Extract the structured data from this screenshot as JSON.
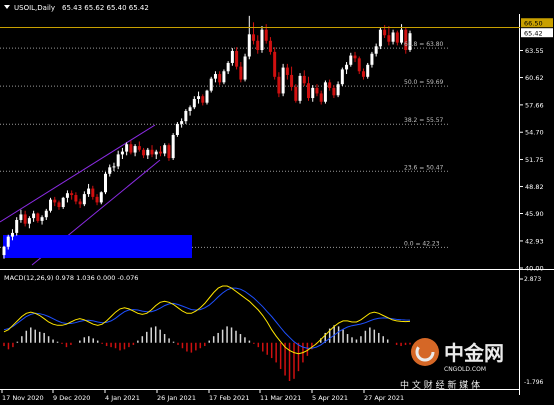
{
  "header": {
    "symbol": "USOIL,Daily",
    "ohlc": "65.43 65.62 65.40 65.42"
  },
  "indicator": {
    "label": "MACD(12,26,9) 0.978 1.036 0.000 -0.076"
  },
  "price_axis": {
    "ticks": [
      "66.50",
      "65.42",
      "63.55",
      "60.62",
      "57.66",
      "54.70",
      "51.75",
      "48.82",
      "45.90",
      "42.93",
      "40.00"
    ],
    "current_price": "65.42",
    "level_price": "66.50",
    "level_color": "#c8a000",
    "current_color": "#ffffff"
  },
  "macd_axis": {
    "ticks": [
      "2.873",
      "-1.796"
    ]
  },
  "time_axis": {
    "labels": [
      "17 Nov 2020",
      "9 Dec 2020",
      "4 Jan 2021",
      "26 Jan 2021",
      "17 Feb 2021",
      "11 Mar 2021",
      "5 Apr 2021",
      "27 Apr 2021"
    ]
  },
  "fibonacci": {
    "levels": [
      "61.8 = 63.80",
      "50.0 = 59.69",
      "38.2 = 55.57",
      "23.6 = 50.47",
      "0.0 = 42.23"
    ]
  },
  "watermark": {
    "brand": "中金网",
    "url": "CNGOLD.COM",
    "slogan": "中 文 财 经 新 媒 体"
  },
  "colors": {
    "bull": "#ffffff",
    "bear": "#d01010",
    "channel": "#8a2be2",
    "highlight": "#0000ff",
    "macd_line": "#ffe600",
    "signal_line": "#1e50ff"
  },
  "chart_data": {
    "type": "candlestick",
    "title": "USOIL,Daily",
    "ylim": [
      40.0,
      67.5
    ],
    "fib_levels": [
      63.8,
      59.69,
      55.57,
      50.47,
      42.23
    ],
    "candles": [
      [
        41.4,
        42.4,
        41.0,
        42.3
      ],
      [
        42.3,
        43.6,
        42.0,
        43.4
      ],
      [
        43.4,
        44.2,
        43.0,
        43.8
      ],
      [
        43.8,
        45.5,
        43.5,
        45.2
      ],
      [
        45.2,
        46.3,
        44.9,
        45.8
      ],
      [
        45.8,
        46.2,
        44.5,
        44.8
      ],
      [
        44.8,
        45.6,
        44.3,
        45.4
      ],
      [
        45.4,
        46.2,
        45.0,
        45.9
      ],
      [
        45.9,
        46.0,
        44.9,
        45.1
      ],
      [
        45.1,
        45.7,
        44.7,
        45.5
      ],
      [
        45.5,
        46.4,
        45.2,
        46.2
      ],
      [
        46.2,
        47.6,
        46.0,
        47.4
      ],
      [
        47.4,
        47.7,
        46.7,
        47.1
      ],
      [
        47.1,
        47.3,
        46.3,
        46.6
      ],
      [
        46.6,
        47.7,
        46.4,
        47.6
      ],
      [
        47.6,
        48.4,
        47.1,
        48.1
      ],
      [
        48.1,
        48.4,
        47.4,
        47.9
      ],
      [
        47.9,
        48.2,
        46.9,
        47.2
      ],
      [
        47.2,
        47.5,
        46.5,
        46.9
      ],
      [
        46.9,
        48.3,
        46.7,
        48.0
      ],
      [
        48.0,
        49.1,
        47.7,
        48.6
      ],
      [
        48.6,
        48.9,
        47.4,
        47.7
      ],
      [
        47.7,
        48.0,
        46.8,
        47.1
      ],
      [
        47.1,
        48.3,
        46.9,
        48.2
      ],
      [
        48.2,
        50.4,
        48.0,
        50.2
      ],
      [
        50.2,
        51.2,
        49.9,
        50.9
      ],
      [
        50.9,
        51.4,
        50.5,
        51.0
      ],
      [
        51.0,
        52.7,
        50.7,
        52.3
      ],
      [
        52.3,
        53.0,
        51.8,
        52.6
      ],
      [
        52.6,
        53.6,
        52.2,
        53.4
      ],
      [
        53.4,
        53.8,
        52.3,
        52.5
      ],
      [
        52.5,
        53.4,
        52.1,
        53.2
      ],
      [
        53.2,
        53.7,
        52.6,
        52.8
      ],
      [
        52.8,
        53.0,
        51.9,
        52.2
      ],
      [
        52.2,
        53.0,
        51.8,
        52.8
      ],
      [
        52.8,
        53.3,
        52.0,
        52.3
      ],
      [
        52.3,
        52.8,
        51.8,
        52.6
      ],
      [
        52.6,
        53.2,
        52.1,
        52.4
      ],
      [
        52.4,
        53.5,
        52.1,
        53.3
      ],
      [
        53.3,
        53.5,
        51.6,
        51.9
      ],
      [
        51.9,
        54.6,
        51.7,
        54.4
      ],
      [
        54.4,
        55.8,
        54.2,
        55.6
      ],
      [
        55.6,
        56.2,
        55.2,
        55.9
      ],
      [
        55.9,
        57.2,
        55.6,
        57.0
      ],
      [
        57.0,
        57.6,
        56.5,
        57.4
      ],
      [
        57.4,
        58.6,
        57.2,
        58.3
      ],
      [
        58.3,
        59.1,
        57.8,
        58.6
      ],
      [
        58.6,
        58.8,
        57.6,
        57.9
      ],
      [
        57.9,
        59.3,
        57.7,
        59.2
      ],
      [
        59.2,
        60.7,
        59.0,
        60.5
      ],
      [
        60.5,
        61.3,
        60.1,
        61.0
      ],
      [
        61.0,
        61.3,
        59.8,
        60.1
      ],
      [
        60.1,
        61.5,
        59.9,
        61.3
      ],
      [
        61.3,
        62.4,
        61.0,
        62.2
      ],
      [
        62.2,
        63.8,
        61.9,
        63.5
      ],
      [
        63.5,
        63.9,
        61.5,
        61.8
      ],
      [
        61.8,
        62.3,
        60.1,
        60.4
      ],
      [
        60.4,
        63.2,
        60.2,
        62.9
      ],
      [
        62.9,
        67.3,
        62.6,
        65.3
      ],
      [
        65.3,
        66.6,
        64.2,
        64.6
      ],
      [
        64.6,
        65.2,
        63.2,
        63.6
      ],
      [
        63.6,
        66.2,
        63.3,
        65.8
      ],
      [
        65.8,
        66.4,
        64.3,
        64.6
      ],
      [
        64.6,
        65.0,
        63.1,
        63.4
      ],
      [
        63.4,
        63.9,
        60.4,
        60.7
      ],
      [
        60.7,
        61.2,
        58.5,
        58.9
      ],
      [
        58.9,
        62.1,
        58.6,
        61.7
      ],
      [
        61.7,
        62.1,
        60.4,
        60.9
      ],
      [
        60.9,
        61.8,
        59.2,
        59.6
      ],
      [
        59.6,
        59.9,
        57.9,
        58.1
      ],
      [
        58.1,
        61.1,
        57.8,
        60.8
      ],
      [
        60.8,
        61.4,
        59.7,
        60.0
      ],
      [
        60.0,
        60.7,
        58.1,
        58.4
      ],
      [
        58.4,
        59.8,
        58.0,
        59.5
      ],
      [
        59.5,
        59.9,
        58.6,
        58.9
      ],
      [
        58.9,
        59.2,
        57.7,
        58.0
      ],
      [
        58.0,
        60.3,
        57.8,
        60.1
      ],
      [
        60.1,
        60.4,
        59.2,
        59.5
      ],
      [
        59.5,
        59.8,
        58.4,
        58.7
      ],
      [
        58.7,
        60.2,
        58.5,
        59.9
      ],
      [
        59.9,
        61.7,
        59.7,
        61.5
      ],
      [
        61.5,
        62.3,
        61.0,
        62.0
      ],
      [
        62.0,
        63.3,
        61.8,
        63.0
      ],
      [
        63.0,
        63.4,
        62.3,
        62.7
      ],
      [
        62.7,
        62.9,
        61.0,
        61.3
      ],
      [
        61.3,
        61.6,
        60.4,
        60.7
      ],
      [
        60.7,
        62.2,
        60.5,
        62.0
      ],
      [
        62.0,
        63.4,
        61.7,
        63.2
      ],
      [
        63.2,
        64.3,
        62.9,
        64.0
      ],
      [
        64.0,
        66.0,
        63.7,
        65.8
      ],
      [
        65.8,
        66.3,
        64.9,
        65.2
      ],
      [
        65.2,
        66.2,
        64.1,
        64.5
      ],
      [
        64.5,
        65.8,
        64.2,
        65.5
      ],
      [
        65.5,
        65.7,
        64.1,
        64.4
      ],
      [
        64.4,
        66.4,
        64.2,
        65.8
      ],
      [
        65.8,
        66.0,
        63.2,
        63.6
      ],
      [
        63.6,
        65.7,
        63.4,
        65.42
      ]
    ],
    "macd": {
      "histogram": [
        -0.15,
        -0.3,
        -0.2,
        0.05,
        0.3,
        0.55,
        0.7,
        0.6,
        0.5,
        0.45,
        0.3,
        0.15,
        0.05,
        -0.05,
        -0.2,
        -0.1,
        0.0,
        0.1,
        0.25,
        0.3,
        0.2,
        0.1,
        -0.05,
        -0.15,
        -0.2,
        -0.25,
        -0.35,
        -0.3,
        -0.2,
        -0.1,
        0.1,
        0.3,
        0.5,
        0.7,
        0.75,
        0.6,
        0.4,
        0.2,
        0.05,
        -0.1,
        -0.25,
        -0.4,
        -0.45,
        -0.35,
        -0.25,
        -0.15,
        0.1,
        0.3,
        0.45,
        0.6,
        0.75,
        0.7,
        0.55,
        0.4,
        0.25,
        0.1,
        -0.05,
        -0.2,
        -0.4,
        -0.55,
        -0.7,
        -0.9,
        -1.2,
        -1.5,
        -1.75,
        -1.65,
        -1.3,
        -0.9,
        -0.6,
        -0.3,
        -0.05,
        0.2,
        0.45,
        0.65,
        0.8,
        0.75,
        0.6,
        0.4,
        0.25,
        0.15,
        0.3,
        0.55,
        0.7,
        0.6,
        0.45,
        0.3,
        0.15,
        0.0,
        -0.1,
        -0.15,
        -0.1,
        -0.08
      ],
      "macd_line": [
        0.5,
        0.6,
        0.8,
        1.0,
        1.2,
        1.35,
        1.4,
        1.35,
        1.25,
        1.1,
        0.95,
        0.85,
        0.8,
        0.8,
        0.85,
        0.95,
        1.05,
        1.1,
        1.05,
        0.95,
        0.85,
        0.8,
        0.85,
        1.0,
        1.2,
        1.4,
        1.55,
        1.6,
        1.55,
        1.45,
        1.35,
        1.3,
        1.35,
        1.5,
        1.7,
        1.85,
        1.9,
        1.85,
        1.75,
        1.6,
        1.45,
        1.35,
        1.35,
        1.45,
        1.6,
        1.8,
        2.05,
        2.3,
        2.5,
        2.6,
        2.6,
        2.5,
        2.35,
        2.2,
        2.05,
        1.9,
        1.7,
        1.5,
        1.25,
        0.95,
        0.6,
        0.3,
        0.05,
        -0.2,
        -0.35,
        -0.45,
        -0.5,
        -0.45,
        -0.35,
        -0.2,
        -0.05,
        0.15,
        0.35,
        0.55,
        0.75,
        0.9,
        1.0,
        1.0,
        0.95,
        0.95,
        1.05,
        1.2,
        1.35,
        1.4,
        1.35,
        1.25,
        1.15,
        1.05,
        1.0,
        0.98,
        0.97,
        0.978
      ],
      "signal_line": [
        0.6,
        0.65,
        0.75,
        0.9,
        1.05,
        1.2,
        1.3,
        1.35,
        1.33,
        1.28,
        1.2,
        1.1,
        1.0,
        0.92,
        0.88,
        0.88,
        0.92,
        0.98,
        1.02,
        1.03,
        1.0,
        0.95,
        0.92,
        0.93,
        1.0,
        1.12,
        1.28,
        1.42,
        1.5,
        1.52,
        1.5,
        1.45,
        1.42,
        1.42,
        1.48,
        1.58,
        1.7,
        1.78,
        1.8,
        1.75,
        1.68,
        1.6,
        1.52,
        1.5,
        1.52,
        1.6,
        1.72,
        1.9,
        2.1,
        2.28,
        2.42,
        2.5,
        2.5,
        2.45,
        2.35,
        2.2,
        2.05,
        1.85,
        1.65,
        1.42,
        1.2,
        0.95,
        0.7,
        0.45,
        0.25,
        0.05,
        -0.1,
        -0.2,
        -0.25,
        -0.25,
        -0.2,
        -0.1,
        0.05,
        0.2,
        0.35,
        0.5,
        0.62,
        0.72,
        0.78,
        0.82,
        0.86,
        0.92,
        1.0,
        1.08,
        1.12,
        1.14,
        1.13,
        1.1,
        1.07,
        1.05,
        1.04,
        1.036
      ]
    }
  }
}
